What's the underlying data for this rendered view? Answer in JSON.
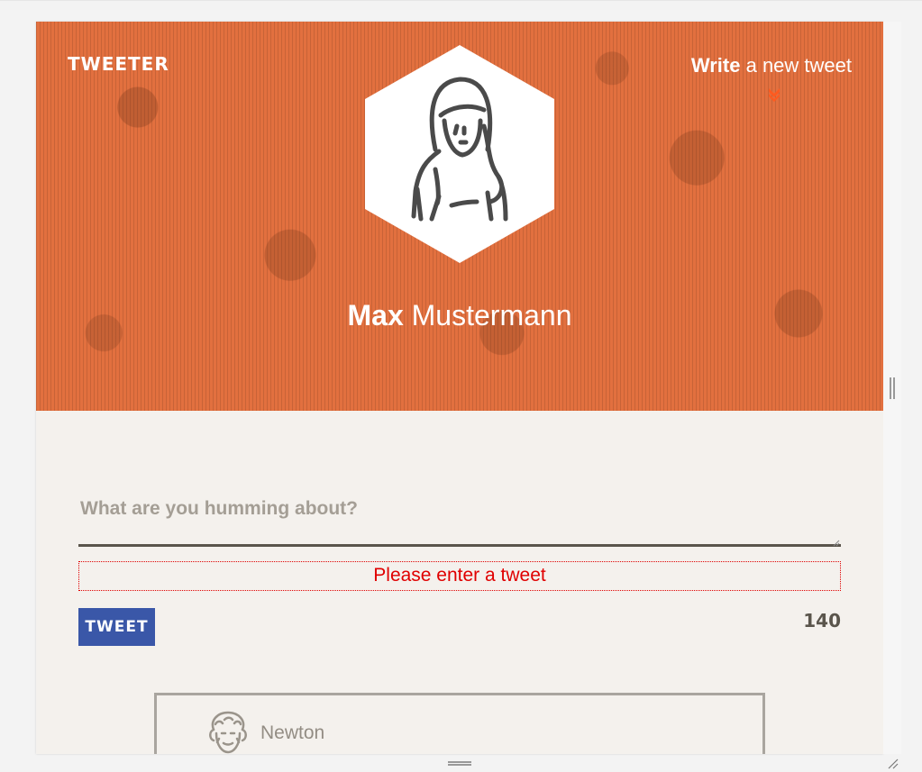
{
  "header": {
    "brand": "TWEETER",
    "write_link_bold": "Write",
    "write_link_rest": " a new tweet",
    "chevron_icon": "double-chevron-down-icon",
    "accent_color": "#e2703f"
  },
  "profile": {
    "first_name": "Max",
    "last_name": " Mustermann",
    "avatar_icon": "woman-avatar-icon"
  },
  "composer": {
    "placeholder": "What are you humming about?",
    "value": "",
    "error": "Please enter a tweet",
    "tweet_button": "TWEET",
    "char_count": "140",
    "button_color": "#3a57a8",
    "error_color": "#e00000"
  },
  "feed": {
    "tweets": [
      {
        "author": "Newton",
        "avatar_icon": "newton-avatar-icon"
      }
    ]
  }
}
